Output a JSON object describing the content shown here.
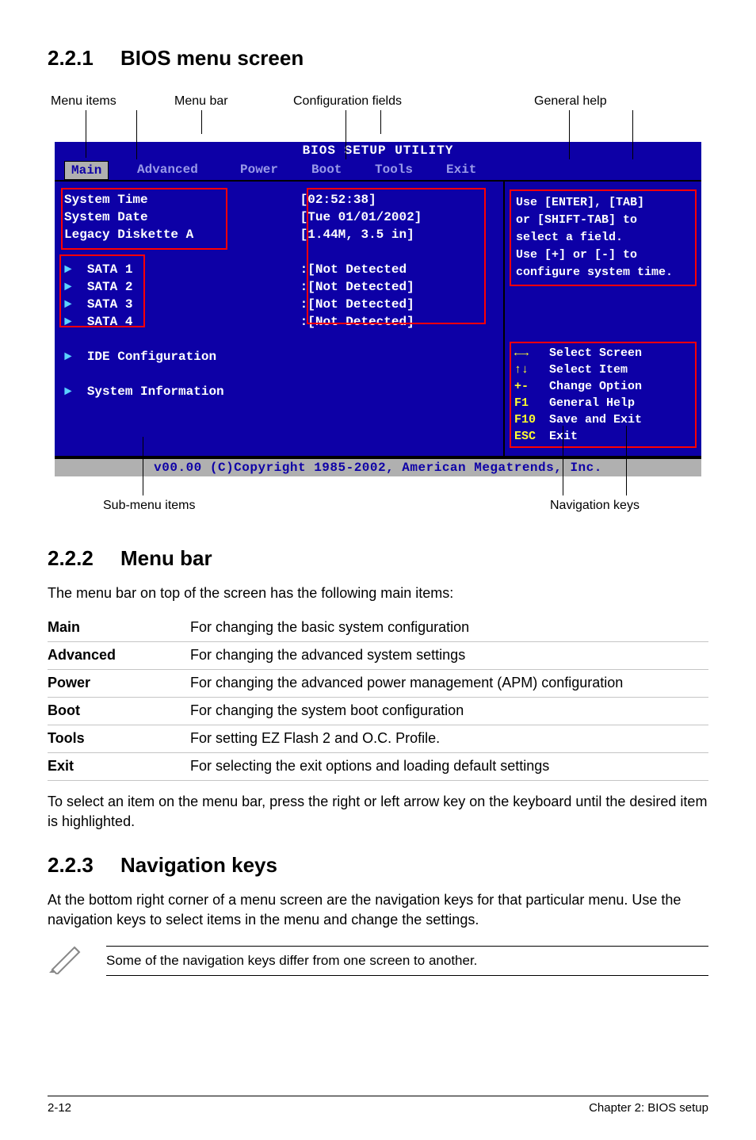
{
  "headings": {
    "s1_num": "2.2.1",
    "s1_title": "BIOS menu screen",
    "s2_num": "2.2.2",
    "s2_title": "Menu bar",
    "s3_num": "2.2.3",
    "s3_title": "Navigation keys"
  },
  "callouts": {
    "menu_items": "Menu items",
    "menu_bar": "Menu bar",
    "config_fields": "Configuration fields",
    "general_help": "General help",
    "sub_menu": "Sub-menu items",
    "nav_keys": "Navigation keys"
  },
  "bios": {
    "title": "BIOS SETUP UTILITY",
    "tabs": {
      "main": "Main",
      "advanced": "Advanced",
      "power": "Power",
      "boot": "Boot",
      "tools": "Tools",
      "exit": "Exit"
    },
    "left_rows": {
      "sys_time_label": "System Time",
      "sys_time_val": "[02:52:38]",
      "sys_date_label": "System Date",
      "sys_date_val": "[Tue 01/01/2002]",
      "legacy_label": "Legacy Diskette A",
      "legacy_val": "[1.44M, 3.5 in]",
      "sata1": "SATA 1",
      "sata2": "SATA 2",
      "sata3": "SATA 3",
      "sata4": "SATA 4",
      "sata1_val": ":[Not Detected",
      "sata2_val": ":[Not Detected]",
      "sata3_val": ":[Not Detected]",
      "sata4_val": ":[Not Detected]",
      "ide_cfg": "IDE Configuration",
      "sys_info": "System Information"
    },
    "help": {
      "l1": "Use [ENTER], [TAB]",
      "l2": "or [SHIFT-TAB] to",
      "l3": "select a field.",
      "l4": "Use [+] or [-] to",
      "l5": "configure system time."
    },
    "nav": {
      "k1": "←→",
      "d1": "Select Screen",
      "k2": "↑↓",
      "d2": "Select Item",
      "k3": "+-",
      "d3": "Change Option",
      "k4": "F1",
      "d4": "General Help",
      "k5": "F10",
      "d5": "Save and Exit",
      "k6": "ESC",
      "d6": "Exit"
    },
    "footer": "v00.00 (C)Copyright 1985-2002, American Megatrends, Inc."
  },
  "menubar": {
    "intro": "The menu bar on top of the screen has the following main items:",
    "items": [
      {
        "k": "Main",
        "v": "For changing the basic system configuration"
      },
      {
        "k": "Advanced",
        "v": "For changing the advanced system settings"
      },
      {
        "k": "Power",
        "v": "For changing the advanced power management (APM) configuration"
      },
      {
        "k": "Boot",
        "v": "For changing the system boot configuration"
      },
      {
        "k": "Tools",
        "v": "For setting EZ Flash 2 and O.C. Profile."
      },
      {
        "k": "Exit",
        "v": "For selecting the exit options and loading default settings"
      }
    ],
    "outro": "To select an item on the menu bar, press the right or left arrow key on the keyboard until the desired item is highlighted."
  },
  "navkeys": {
    "p": "At the bottom right corner of a menu screen are the navigation keys for that particular menu. Use the navigation keys to select items in the menu and change the settings.",
    "note": "Some of the navigation keys differ from one screen to another."
  },
  "footer": {
    "page": "2-12",
    "chapter": "Chapter 2: BIOS setup"
  }
}
